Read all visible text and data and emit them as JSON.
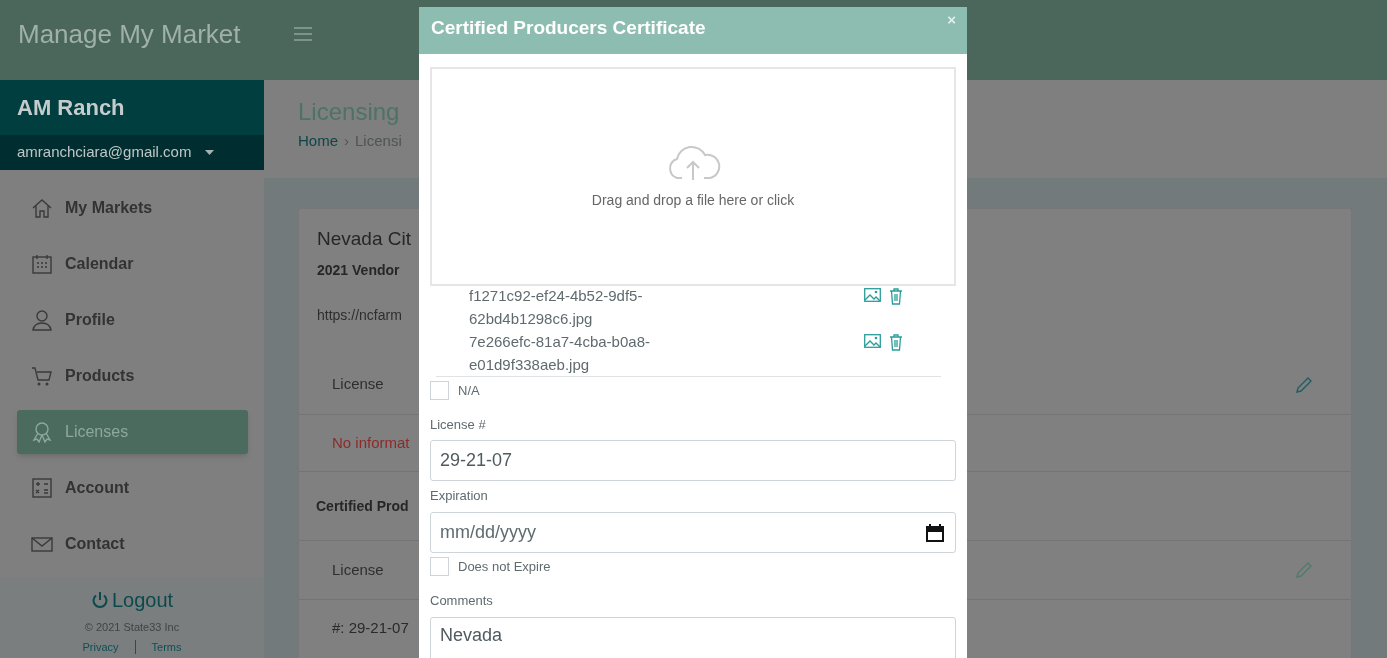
{
  "app": {
    "title": "Manage My Market"
  },
  "sidebar": {
    "account_name": "AM Ranch",
    "email": "amranchciara@gmail.com",
    "items": [
      {
        "label": "My Markets",
        "selected": false
      },
      {
        "label": "Calendar",
        "selected": false
      },
      {
        "label": "Profile",
        "selected": false
      },
      {
        "label": "Products",
        "selected": false
      },
      {
        "label": "Licenses",
        "selected": true
      },
      {
        "label": "Account",
        "selected": false
      },
      {
        "label": "Contact",
        "selected": false
      }
    ],
    "logout": "Logout",
    "copyright": "© 2021 State33 Inc",
    "links": [
      "Privacy",
      "Terms"
    ]
  },
  "page": {
    "title": "Licensing",
    "breadcrumb": [
      "Home",
      "Licensi"
    ],
    "separator": "›"
  },
  "card": {
    "title": "Nevada Cit",
    "subtitle": "2021 Vendor",
    "url": "https://ncfarm",
    "rows": [
      {
        "kind": "license",
        "text": "License",
        "editable": true
      },
      {
        "kind": "empty",
        "text": "No informat"
      },
      {
        "kind": "heading",
        "text": "Certified Prod"
      },
      {
        "kind": "license",
        "text": "License",
        "editable": true
      },
      {
        "kind": "number",
        "text": "#: 29-21-07"
      }
    ]
  },
  "modal": {
    "title": "Certified Producers Certificate",
    "close": "×",
    "dropzone": "Drag and drop a file here or click",
    "files": [
      "f1271c92-ef24-4b52-9df5-62bd4b1298c6.jpg",
      "7e266efc-81a7-4cba-b0a8-e01d9f338aeb.jpg"
    ],
    "na": {
      "label": "N/A",
      "checked": false
    },
    "license_number": {
      "label": "License #",
      "value": "29-21-07"
    },
    "expiration": {
      "label": "Expiration",
      "placeholder": "mm/dd/yyyy"
    },
    "does_not_expire": {
      "label": "Does not Expire",
      "checked": false
    },
    "comments": {
      "label": "Comments",
      "value": "Nevada"
    }
  }
}
